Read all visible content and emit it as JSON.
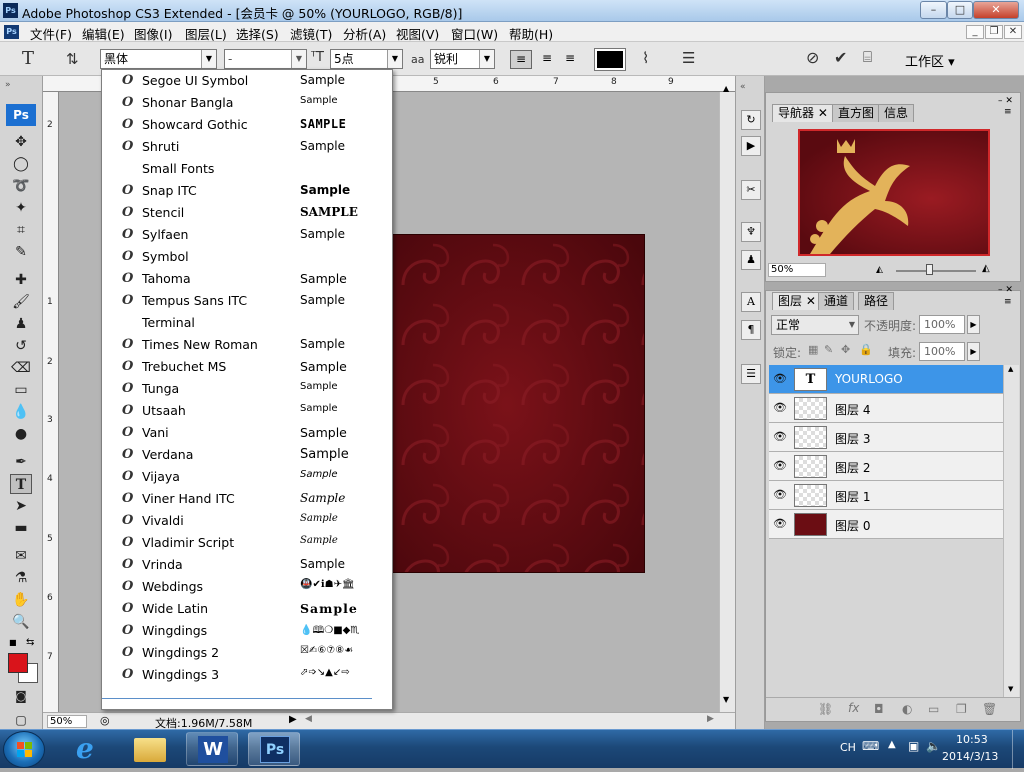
{
  "window": {
    "title": "Adobe Photoshop CS3 Extended - [会员卡 @ 50% (YOURLOGO, RGB/8)]",
    "app_icon": "Ps"
  },
  "menu": [
    "文件(F)",
    "编辑(E)",
    "图像(I)",
    "图层(L)",
    "选择(S)",
    "滤镜(T)",
    "分析(A)",
    "视图(V)",
    "窗口(W)",
    "帮助(H)"
  ],
  "options": {
    "tool_icon": "T",
    "font_family": "黑体",
    "font_style": "-",
    "font_size": "5点",
    "aa_label": "aa",
    "antialias": "锐利",
    "text_color": "#000000",
    "workspace_label": "工作区"
  },
  "rulers": {
    "h": [
      "5",
      "6",
      "7",
      "8",
      "9"
    ],
    "v": [
      "2",
      "1",
      "2",
      "3",
      "4",
      "5",
      "6",
      "7"
    ]
  },
  "status": {
    "zoom": "50%",
    "doc_size": "文档:1.96M/7.58M"
  },
  "font_menu": {
    "items": [
      {
        "name": "Segoe UI Symbol",
        "sample": "Sample",
        "o": true
      },
      {
        "name": "Shonar Bangla",
        "sample": "Sample",
        "o": true
      },
      {
        "name": "Showcard Gothic",
        "sample": "SAMPLE",
        "o": true
      },
      {
        "name": "Shruti",
        "sample": "Sample",
        "o": true
      },
      {
        "name": "Small Fonts",
        "sample": "",
        "o": false
      },
      {
        "name": "Snap ITC",
        "sample": "Sample",
        "o": true
      },
      {
        "name": "Stencil",
        "sample": "SAMPLE",
        "o": true
      },
      {
        "name": "Sylfaen",
        "sample": "Sample",
        "o": true
      },
      {
        "name": "Symbol",
        "sample": "",
        "o": true
      },
      {
        "name": "Tahoma",
        "sample": "Sample",
        "o": true
      },
      {
        "name": "Tempus Sans ITC",
        "sample": "Sample",
        "o": true
      },
      {
        "name": "Terminal",
        "sample": "",
        "o": false
      },
      {
        "name": "Times New Roman",
        "sample": "Sample",
        "o": true
      },
      {
        "name": "Trebuchet MS",
        "sample": "Sample",
        "o": true
      },
      {
        "name": "Tunga",
        "sample": "Sample",
        "o": true
      },
      {
        "name": "Utsaah",
        "sample": "Sample",
        "o": true
      },
      {
        "name": "Vani",
        "sample": "Sample",
        "o": true
      },
      {
        "name": "Verdana",
        "sample": "Sample",
        "o": true
      },
      {
        "name": "Vijaya",
        "sample": "Sample",
        "o": true
      },
      {
        "name": "Viner Hand ITC",
        "sample": "Sample",
        "o": true
      },
      {
        "name": "Vivaldi",
        "sample": "Sample",
        "o": true
      },
      {
        "name": "Vladimir Script",
        "sample": "Sample",
        "o": true
      },
      {
        "name": "Vrinda",
        "sample": "Sample",
        "o": true
      },
      {
        "name": "Webdings",
        "sample": "🚇✔ℹ☗✈🏛",
        "o": true
      },
      {
        "name": "Wide Latin",
        "sample": "Sample",
        "o": true
      },
      {
        "name": "Wingdings",
        "sample": "💧🕮❍■◆♏",
        "o": true
      },
      {
        "name": "Wingdings 2",
        "sample": "☒✍⑥⑦⑧☙",
        "o": true
      },
      {
        "name": "Wingdings 3",
        "sample": "⬀➩↘▲↙⇨",
        "o": true
      }
    ]
  },
  "navigator": {
    "tabs": [
      "导航器",
      "直方图",
      "信息"
    ],
    "zoom": "50%"
  },
  "layers_panel": {
    "tabs": [
      "图层",
      "通道",
      "路径"
    ],
    "blend_mode": "正常",
    "opacity_label": "不透明度:",
    "opacity": "100%",
    "lock_label": "锁定:",
    "fill_label": "填充:",
    "fill": "100%",
    "layers": [
      {
        "name": "YOURLOGO",
        "type": "text",
        "selected": true
      },
      {
        "name": "图层 4",
        "type": "pixel",
        "selected": false
      },
      {
        "name": "图层 3",
        "type": "pixel",
        "selected": false
      },
      {
        "name": "图层 2",
        "type": "pixel",
        "selected": false
      },
      {
        "name": "图层 1",
        "type": "pixel",
        "selected": false
      },
      {
        "name": "图层 0",
        "type": "fill",
        "selected": false
      }
    ]
  },
  "taskbar": {
    "lang": "CH",
    "time": "10:53",
    "date": "2014/3/13"
  },
  "colors": {
    "foreground": "#d9141b",
    "background": "#ffffff",
    "doc_bg": "#6b0d13",
    "layer_selected": "#3d95e8"
  }
}
